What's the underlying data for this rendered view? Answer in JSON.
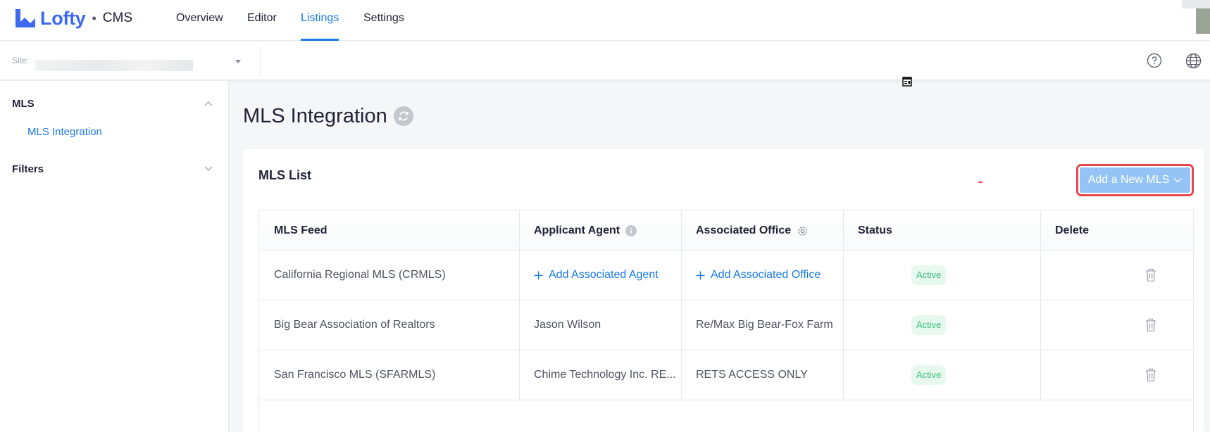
{
  "app": {
    "logo_text": "Lofty",
    "separator": "•",
    "product": "CMS",
    "brand_color": "#3d68f0",
    "accent_color": "#1a7ae4"
  },
  "nav": {
    "tabs": [
      {
        "label": "Overview",
        "active": false
      },
      {
        "label": "Editor",
        "active": false
      },
      {
        "label": "Listings",
        "active": true
      },
      {
        "label": "Settings",
        "active": false
      }
    ]
  },
  "subbar": {
    "site_label": "Site:",
    "icons": [
      "help-icon",
      "globe-icon"
    ]
  },
  "sidebar": {
    "groups": [
      {
        "label": "MLS",
        "expanded": true,
        "items": [
          {
            "label": "MLS Integration",
            "active": true
          }
        ]
      },
      {
        "label": "Filters",
        "expanded": false,
        "items": []
      }
    ]
  },
  "main": {
    "title": "MLS Integration",
    "card_title": "MLS List",
    "add_button_label": "Add a New MLS",
    "table": {
      "columns": [
        "MLS Feed",
        "Applicant Agent",
        "Associated Office",
        "Status",
        "Delete"
      ],
      "rows": [
        {
          "feed": "California Regional MLS (CRMLS)",
          "agent": "Add Associated Agent",
          "agent_is_action": true,
          "office": "Add Associated Office",
          "office_is_action": true,
          "status": "Active"
        },
        {
          "feed": "Big Bear Association of Realtors",
          "agent": "Jason Wilson",
          "agent_is_action": false,
          "office": "Re/Max Big Bear-Fox Farm",
          "office_is_action": false,
          "status": "Active"
        },
        {
          "feed": "San Francisco MLS (SFARMLS)",
          "agent": "Chime Technology Inc. RE...",
          "agent_is_action": false,
          "office": "RETS ACCESS ONLY",
          "office_is_action": false,
          "status": "Active"
        }
      ]
    },
    "status_colors": {
      "active_bg": "#e7f8ee",
      "active_text": "#3ac07a"
    }
  }
}
